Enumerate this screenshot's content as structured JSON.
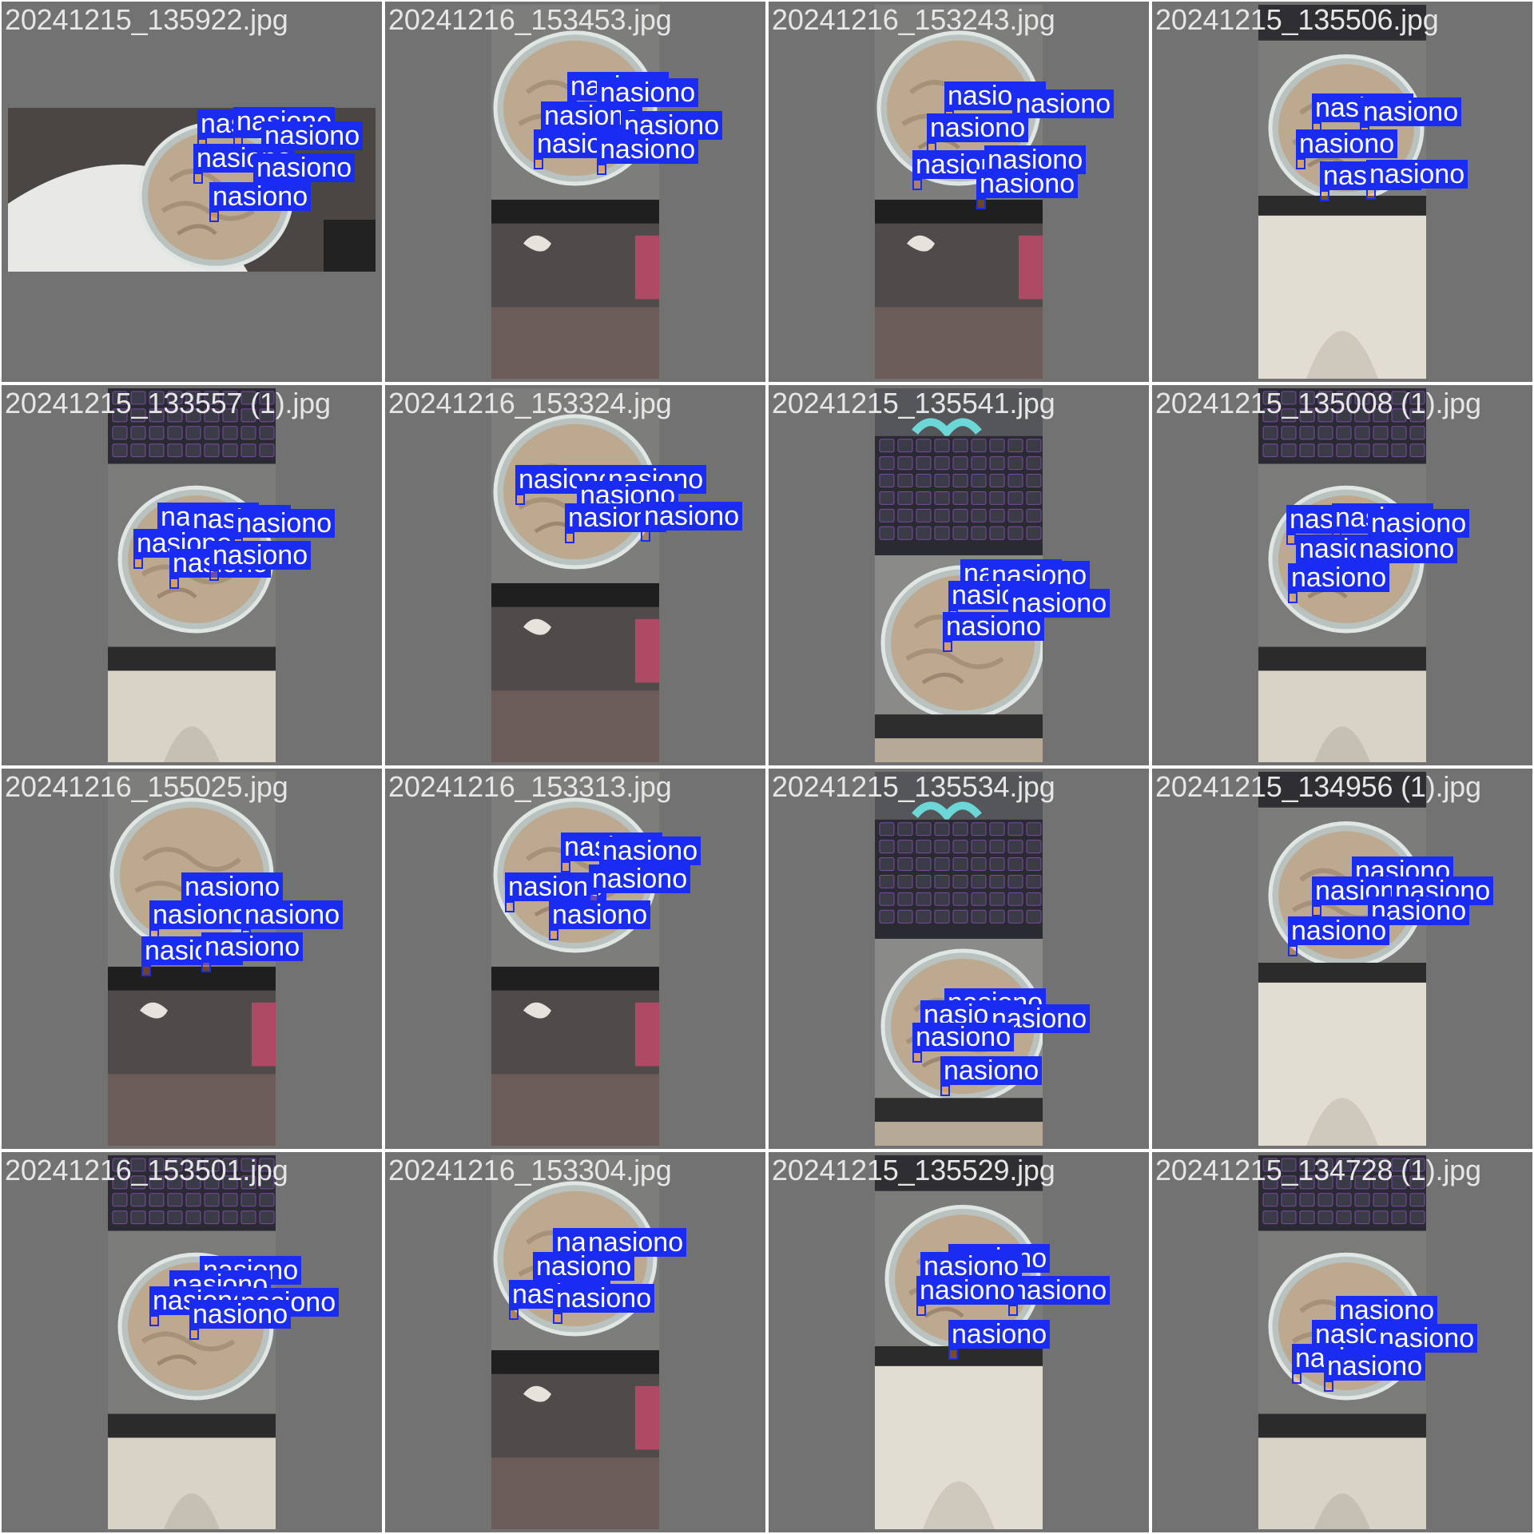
{
  "grid": {
    "tiles": [
      {
        "filename": "20241215_135922.jpg",
        "scene": "landscape",
        "labels": [
          "nasiono",
          "nasiono",
          "nasiono",
          "nasiono",
          "nasiono",
          "nasiono"
        ]
      },
      {
        "filename": "20241216_153453.jpg",
        "scene": "portrait-dish-top",
        "labels": [
          "nasiono",
          "nasiono",
          "nasiono",
          "nasiono",
          "nasiono",
          "nasiono"
        ]
      },
      {
        "filename": "20241216_153243.jpg",
        "scene": "portrait-dish-top",
        "labels": [
          "nasiono",
          "nasiono",
          "nasiono",
          "nasiono",
          "nasiono",
          "nasiono"
        ]
      },
      {
        "filename": "20241215_135506.jpg",
        "scene": "portrait-dish-lap",
        "labels": [
          "nasiono",
          "nasiono",
          "nasiono",
          "nasiono",
          "nasiono"
        ]
      },
      {
        "filename": "20241215_133557 (1).jpg",
        "scene": "portrait-keyboard-dish-lap",
        "labels": [
          "nasiono",
          "nasiono",
          "nasiono",
          "nasiono",
          "nasiono",
          "nasiono"
        ]
      },
      {
        "filename": "20241216_153324.jpg",
        "scene": "portrait-dish-top",
        "labels": [
          "nasiono",
          "nasiono",
          "nasiono",
          "nasiono",
          "nasiono"
        ]
      },
      {
        "filename": "20241215_135541.jpg",
        "scene": "portrait-keyboard-dish",
        "labels": [
          "nasiono",
          "nasiono",
          "nasiono",
          "nasiono",
          "nasiono"
        ]
      },
      {
        "filename": "20241215_135008 (1).jpg",
        "scene": "portrait-keyboard-dish-lap",
        "labels": [
          "nasiono",
          "nasiono",
          "nasiono",
          "nasiono",
          "nasiono",
          "nasiono"
        ]
      },
      {
        "filename": "20241216_155025.jpg",
        "scene": "portrait-dish-top",
        "labels": [
          "nasiono",
          "nasiono",
          "nasiono",
          "nasiono",
          "nasiono"
        ]
      },
      {
        "filename": "20241216_153313.jpg",
        "scene": "portrait-dish-top",
        "labels": [
          "nasiono",
          "nasiono",
          "nasiono",
          "nasiono",
          "nasiono"
        ]
      },
      {
        "filename": "20241215_135534.jpg",
        "scene": "portrait-keyboard-dish",
        "labels": [
          "nasiono",
          "nasiono",
          "nasiono",
          "nasiono",
          "nasiono"
        ]
      },
      {
        "filename": "20241215_134956 (1).jpg",
        "scene": "portrait-dish-lap",
        "labels": [
          "nasiono",
          "nasiono",
          "nasiono",
          "nasiono",
          "nasiono"
        ]
      },
      {
        "filename": "20241216_153501.jpg",
        "scene": "portrait-keyboard-dish-top",
        "labels": [
          "nasiono",
          "nasiono",
          "nasiono",
          "nasiono",
          "nasiono"
        ]
      },
      {
        "filename": "20241216_153304.jpg",
        "scene": "portrait-dish-top",
        "labels": [
          "nasiono",
          "nasiono",
          "nasiono",
          "nasiono",
          "nasiono"
        ]
      },
      {
        "filename": "20241215_135529.jpg",
        "scene": "portrait-dish-lap",
        "labels": [
          "nasiono",
          "nasiono",
          "nasiono",
          "nasiono",
          "nasiono"
        ]
      },
      {
        "filename": "20241215_134728 (1).jpg",
        "scene": "portrait-keyboard-dish-lap",
        "labels": [
          "nasiono",
          "nasiono",
          "nasiono",
          "nasiono",
          "nasiono"
        ]
      }
    ]
  },
  "colors": {
    "tile_background": "#727272",
    "label_background": "#1a2cf2",
    "label_text": "#ffffff",
    "filename_text": "#e6e6e6"
  }
}
